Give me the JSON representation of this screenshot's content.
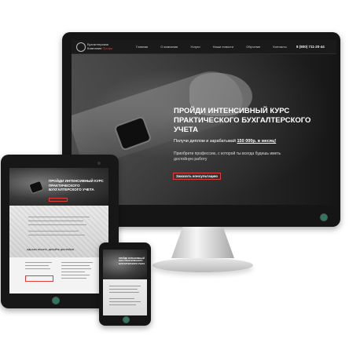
{
  "monitor": {
    "logo": {
      "line1": "Бухгалтерская",
      "line2a": "Компания",
      "line2b": "Профи"
    },
    "nav": [
      "Главная",
      "О компании",
      "Услуги",
      "Наши новости",
      "Обучение",
      "Контакты"
    ],
    "phone": "8 (800) 711-20-44",
    "hero": {
      "title": "ПРОЙДИ ИНТЕНСИВНЫЙ КУРС ПРАКТИЧЕСКОГО БУХГАЛТЕРСКОГО УЧЕТА",
      "subtitle_prefix": "Получи диплом и зарабатывай",
      "subtitle_highlight": "150 000р. в месяц!",
      "text": "Приобрети профессию, с которой ты всегда будешь иметь достойную работу",
      "button": "Заказать консультацию"
    }
  },
  "tablet": {
    "hero_title": "ПРОЙДИ ИНТЕНСИВНЫЙ КУРС ПРАКТИЧЕСКОГО БУХГАЛТЕРСКОГО УЧЕТА",
    "section_heading": "ОДНАКО РАБОТА, ДЕЛАЙТЕ ДОСТОЙНО"
  },
  "phone": {
    "hero_title": "ПРОЙДИ ИНТЕНСИВНЫЙ КУРС ПРАКТИЧЕСКОГО БУХГАЛТЕРСКОГО УЧЕТА"
  },
  "colors": {
    "accent": "#e23c3c",
    "power_led": "#2b7a5d",
    "bezel": "#151515"
  }
}
